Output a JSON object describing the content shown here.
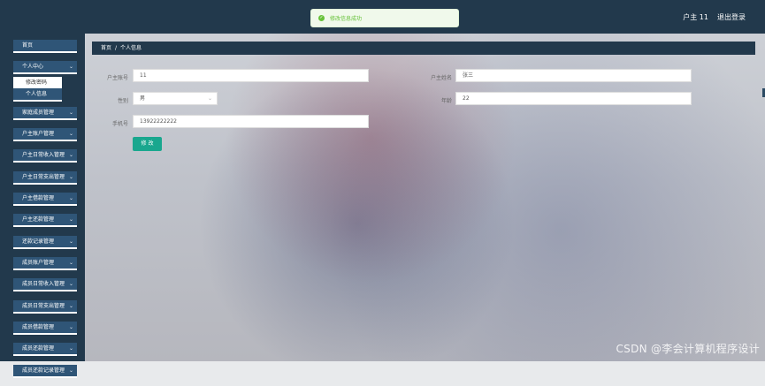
{
  "toast": {
    "message": "修改信息成功"
  },
  "header": {
    "user_label": "户主 11",
    "logout_label": "退出登录"
  },
  "sidebar": {
    "items": [
      {
        "label": "首页",
        "has_chevron": false
      },
      {
        "label": "个人中心",
        "has_chevron": true
      },
      {
        "label": "家庭成员管理",
        "has_chevron": true
      },
      {
        "label": "户主账户管理",
        "has_chevron": true
      },
      {
        "label": "户主日常收入管理",
        "has_chevron": true
      },
      {
        "label": "户主日常支出管理",
        "has_chevron": true
      },
      {
        "label": "户主借款管理",
        "has_chevron": true
      },
      {
        "label": "户主还款管理",
        "has_chevron": true
      },
      {
        "label": "还款记录管理",
        "has_chevron": true
      },
      {
        "label": "成员账户管理",
        "has_chevron": true
      },
      {
        "label": "成员日常收入管理",
        "has_chevron": true
      },
      {
        "label": "成员日常支出管理",
        "has_chevron": true
      },
      {
        "label": "成员借款管理",
        "has_chevron": true
      },
      {
        "label": "成员还款管理",
        "has_chevron": true
      },
      {
        "label": "成员还款记录管理",
        "has_chevron": true
      }
    ],
    "submenu": {
      "change_password": "修改密码",
      "personal_info": "个人信息"
    }
  },
  "breadcrumb": {
    "home": "首页",
    "separator": "/",
    "current": "个人信息"
  },
  "form": {
    "account_label": "户主账号",
    "account_value": "11",
    "name_label": "户主姓名",
    "name_value": "张三",
    "gender_label": "性别",
    "gender_value": "男",
    "age_label": "年龄",
    "age_value": "22",
    "phone_label": "手机号",
    "phone_value": "13922222222",
    "submit_label": "修 改"
  },
  "watermark": "CSDN @李会计算机程序设计",
  "colors": {
    "nav_bg": "#22394c",
    "menu_bg": "#2f5577",
    "accent": "#19a78e",
    "success": "#67c23a"
  }
}
